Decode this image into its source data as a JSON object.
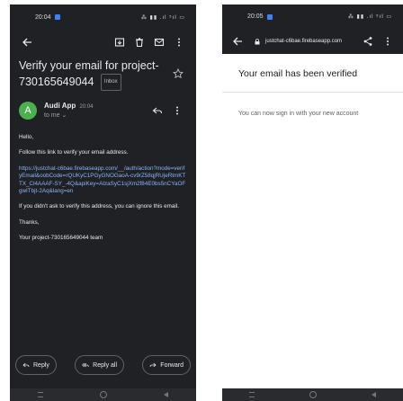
{
  "left_phone": {
    "status_time": "20:04",
    "status_icons": "⁂ ▮▮ .ıl ⁵ıl ▭",
    "subject": "Verify your email for project-730165649044",
    "inbox_chip": "Inbox",
    "sender": {
      "avatar_letter": "A",
      "avatar_color": "#4caf50",
      "name": "Audi App",
      "time": "20:04",
      "to": "to me ⌄"
    },
    "body": {
      "greeting": "Hello,",
      "instruction": "Follow this link to verify your email address.",
      "link": "https://justchat-c6bae.firebaseapp.com/__/auth/action?mode=verifyEmail&oobCode=rQUKyC1PGyGNOGaoA-cv9rZ58qjRUjeRtmKTTX_Cl4AAAF-SY_-4Q&apiKey=AIzaSyC1sjXm2f84E0bs5nCYaOFgwITbjt-2Aq&lang=en",
      "ignore": "If you didn't ask to verify this address, you can ignore this email.",
      "thanks": "Thanks,",
      "signature": "Your project-730165649044 team"
    },
    "actions": {
      "reply": "Reply",
      "reply_all": "Reply all",
      "forward": "Forward"
    }
  },
  "right_phone": {
    "status_time": "20:05",
    "status_icons": "⁂ ▮▮ .ıl ⁵ıl ▭",
    "url": "justchat-c6bae.firebaseapp.com",
    "title": "Your email has been verified",
    "message": "You can now sign in with your new account"
  }
}
